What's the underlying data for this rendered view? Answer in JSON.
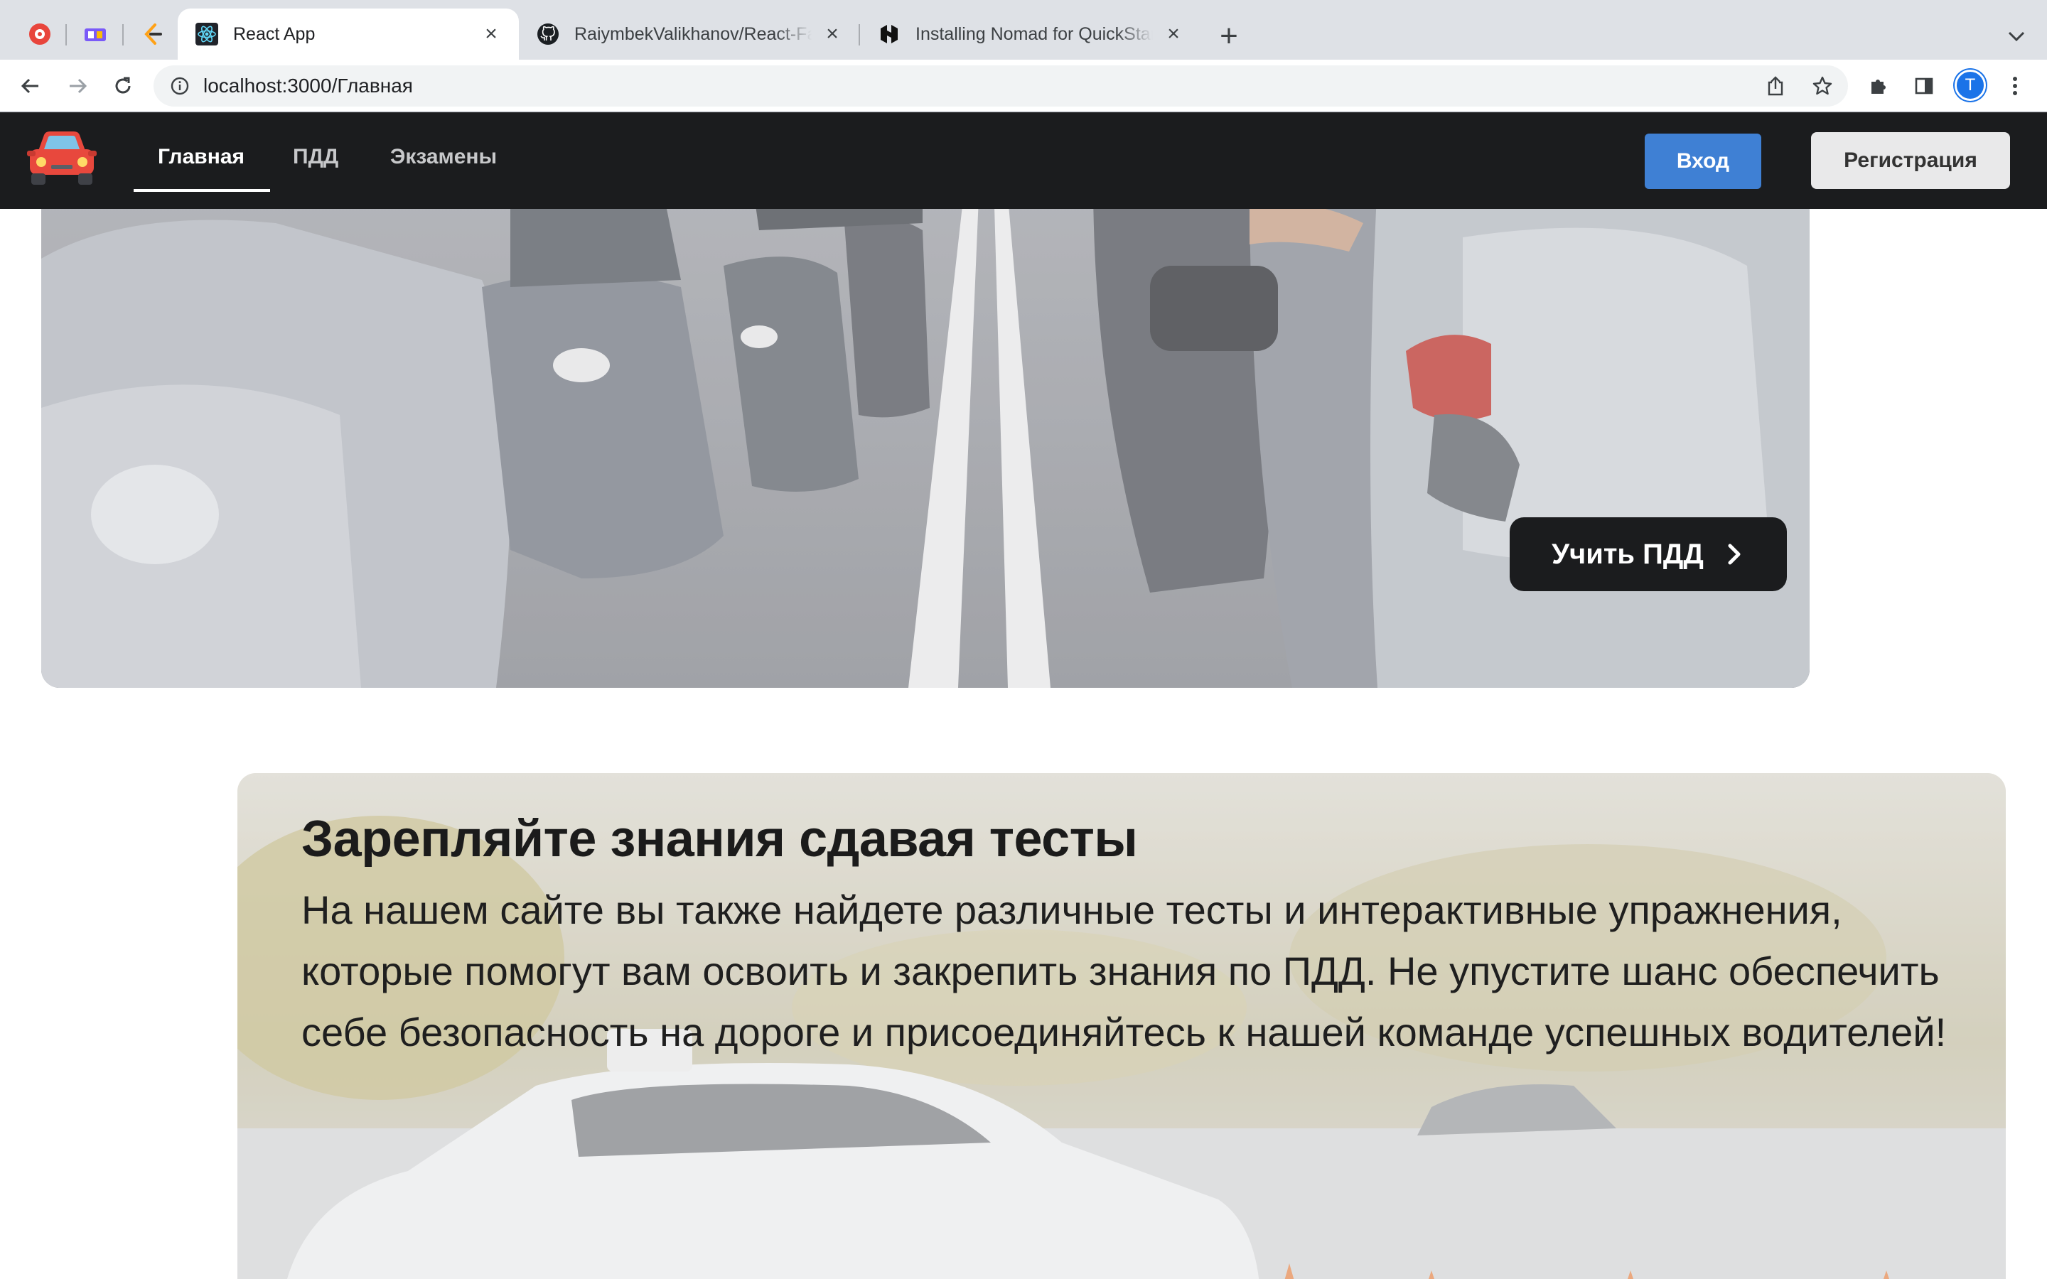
{
  "browser": {
    "tabs": [
      {
        "title": "React App",
        "active": true
      },
      {
        "title": "RaiymbekValikhanov/React-Fal",
        "active": false
      },
      {
        "title": "Installing Nomad for QuickStart",
        "active": false
      }
    ],
    "url": "localhost:3000/Главная",
    "profile_initial": "T"
  },
  "nav": {
    "links": [
      "Главная",
      "ПДД",
      "Экзамены"
    ],
    "active_index": 0,
    "login_label": "Вход",
    "register_label": "Регистрация"
  },
  "hero": {
    "button_label": "Учить ПДД"
  },
  "quiz_section": {
    "title": "Зарепляйте знания сдавая тесты",
    "text": "На нашем сайте вы также найдете различные тесты и интерактивные упражнения, которые помогут вам освоить и закрепить знания по ПДД. Не упустите шанс обеспечить себе безопасность на дороге и присоединяйтесь к нашей команде успешных водителей!"
  },
  "colors": {
    "nav_bg": "#1b1c1e",
    "login_bg": "#3f80d4",
    "register_bg": "#e9e9ea",
    "tabstrip_bg": "#dee1e6"
  }
}
